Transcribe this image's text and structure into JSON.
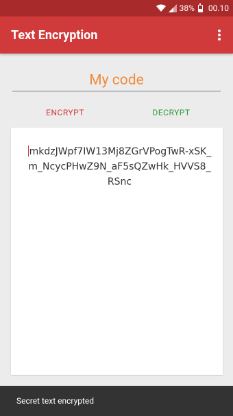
{
  "status_bar": {
    "battery": "38%",
    "time": "00.10"
  },
  "app_bar": {
    "title": "Text Encryption"
  },
  "key_field": {
    "value": "My code"
  },
  "actions": {
    "encrypt": "ENCRYPT",
    "decrypt": "DECRYPT"
  },
  "text_area": {
    "value": "mkdzJWpf7IW13Mj8ZGrVPogTwR-xSK_m_NcycPHwZ9N_aF5sQZwHk_HVVS8_RSnc"
  },
  "snackbar": {
    "message": "Secret text encrypted"
  },
  "colors": {
    "app_bar": "#d13a3a",
    "status_bar": "#a92a2a",
    "key_text": "#f08a3a",
    "encrypt": "#d13a3a",
    "decrypt": "#2e9a3a"
  }
}
